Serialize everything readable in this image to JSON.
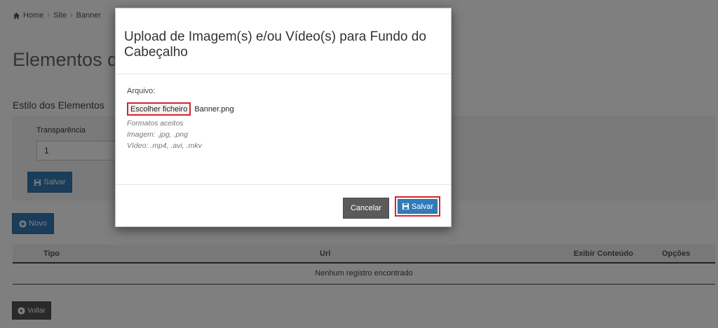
{
  "breadcrumb": {
    "items": [
      "Home",
      "Site",
      "Banner"
    ],
    "home_icon": "home-icon"
  },
  "page": {
    "title": "Elementos do",
    "section_title": "Estilo dos Elementos",
    "transparency_label": "Transparência",
    "transparency_value": "1",
    "save_label": "Salvar",
    "new_label": "Novo",
    "back_label": "Voltar"
  },
  "table": {
    "columns": [
      "Tipo",
      "Url",
      "Exibir Conteúdo",
      "Opções"
    ],
    "empty_message": "Nenhum registro encontrado"
  },
  "modal": {
    "title": "Upload de Imagem(s) e/ou Vídeo(s) para Fundo do Cabeçalho",
    "file_label": "Arquivo:",
    "choose_file_label": "Escolher ficheiro",
    "file_name": "Banner.png",
    "help_lines": [
      "Formatos aceitos",
      "Imagem: .jpg, .png",
      "Vídeo: .mp4, .avi, .mkv"
    ],
    "cancel_label": "Cancelar",
    "save_label": "Salvar"
  },
  "colors": {
    "primary": "#337ab7",
    "highlight": "#d9232d",
    "cancel": "#5a5a5a"
  }
}
